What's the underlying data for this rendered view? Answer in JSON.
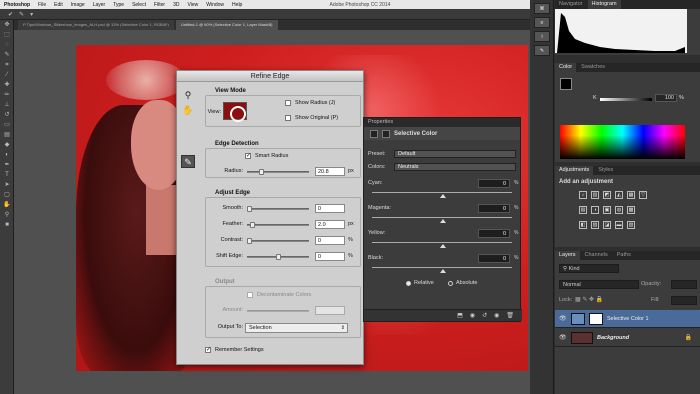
{
  "menubar": {
    "app": "Photoshop",
    "items": [
      "File",
      "Edit",
      "Image",
      "Layer",
      "Type",
      "Select",
      "Filter",
      "3D",
      "View",
      "Window",
      "Help"
    ],
    "window_title": "Adobe Photoshop CC 2014"
  },
  "doc_tabs": [
    "P Tips/Windows_Slideshow_Images_ALH.psd @ 13% (Selective Color 1, RGB/8*)",
    "Untitled-1 @ 60% (Selective Color 1, Layer Mask/8)"
  ],
  "refine_edge": {
    "title": "Refine Edge",
    "view_mode": {
      "title": "View Mode",
      "view_label": "View:",
      "show_radius": "Show Radius (J)",
      "show_original": "Show Original (P)"
    },
    "edge_detection": {
      "title": "Edge Detection",
      "smart_radius": "Smart Radius",
      "radius_label": "Radius:",
      "radius_value": "20.8",
      "radius_unit": "px",
      "radius_level": 0.2
    },
    "adjust_edge": {
      "title": "Adjust Edge",
      "rows": [
        {
          "label": "Smooth:",
          "value": "0",
          "unit": "",
          "level": 0.0
        },
        {
          "label": "Feather:",
          "value": "2.0",
          "unit": "px",
          "level": 0.05
        },
        {
          "label": "Contrast:",
          "value": "0",
          "unit": "%",
          "level": 0.0
        },
        {
          "label": "Shift Edge:",
          "value": "0",
          "unit": "%",
          "level": 0.5
        }
      ]
    },
    "output": {
      "title": "Output",
      "decontaminate": "Decontaminate Colors",
      "amount_label": "Amount:",
      "output_to_label": "Output To:",
      "output_to_value": "Selection"
    },
    "remember_settings": "Remember Settings"
  },
  "properties": {
    "tab": "Properties",
    "title": "Selective Color",
    "preset_label": "Preset:",
    "preset_value": "Default",
    "colors_label": "Colors:",
    "colors_value": "Neutrals",
    "rows": [
      {
        "label": "Cyan:",
        "value": "0",
        "unit": "%"
      },
      {
        "label": "Magenta:",
        "value": "0",
        "unit": "%"
      },
      {
        "label": "Yellow:",
        "value": "0",
        "unit": "%"
      },
      {
        "label": "Black:",
        "value": "0",
        "unit": "%"
      }
    ],
    "relative": "Relative",
    "absolute": "Absolute"
  },
  "dock": {
    "top_tabs": [
      "Navigator",
      "Histogram"
    ],
    "color_tabs": [
      "Color",
      "Swatches"
    ],
    "color_channel": "K",
    "color_value": "100",
    "color_unit": "%",
    "adj_tabs": [
      "Adjustments",
      "Styles"
    ],
    "add_adjustment": "Add an adjustment",
    "layer_tabs": [
      "Layers",
      "Channels",
      "Paths"
    ],
    "kind_label": "Kind",
    "blend_mode": "Normal",
    "opacity_label": "Opacity:",
    "lock_label": "Lock:",
    "fill_label": "Fill:",
    "layers": [
      {
        "name": "Selective Color 1"
      },
      {
        "name": "Background"
      }
    ]
  }
}
